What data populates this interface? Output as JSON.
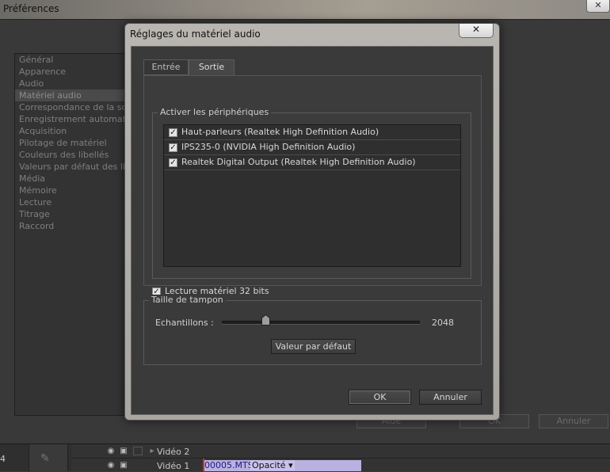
{
  "background": {
    "window_title": "Préférences",
    "close_glyph": "✕",
    "categories": [
      "Général",
      "Apparence",
      "Audio",
      "Matériel audio",
      "Correspondance de la sortie",
      "Enregistrement automatique",
      "Acquisition",
      "Pilotage de matériel",
      "Couleurs des libellés",
      "Valeurs par défaut des libellés",
      "Média",
      "Mémoire",
      "Lecture",
      "Titrage",
      "Raccord"
    ],
    "selected_category": "Matériel audio",
    "buttons": {
      "aide": "Aide",
      "ok": "OK",
      "annuler": "Annuler"
    }
  },
  "timeline": {
    "left_number": "4",
    "pen_icon": "pen-icon",
    "track_video2": "Vidéo 2",
    "track_video1": "Vidéo 1",
    "clip_name": "00005.MTS",
    "clip_property": "Opacité ▾"
  },
  "dialog": {
    "title": "Réglages du matériel audio",
    "close_glyph": "✕",
    "tabs": [
      {
        "label": "Entrée",
        "active": false
      },
      {
        "label": "Sortie",
        "active": true
      }
    ],
    "devices_group_label": "Activer les périphériques",
    "devices": [
      {
        "label": "Haut-parleurs (Realtek High Definition Audio)",
        "checked": true
      },
      {
        "label": "IPS235-0 (NVIDIA High Definition Audio)",
        "checked": true
      },
      {
        "label": "Realtek Digital Output (Realtek High Definition Audio)",
        "checked": true
      }
    ],
    "hardware_32bit_label": "Lecture matériel 32 bits",
    "hardware_32bit_checked": true,
    "buffer_group_label": "Taille de tampon",
    "samples_label": "Echantillons :",
    "samples_value": "2048",
    "default_button": "Valeur par défaut",
    "ok_button": "OK",
    "cancel_button": "Annuler"
  },
  "colors": {
    "clip": "#b9b2e0",
    "dialog_frame": "#b0ada8",
    "panel": "#3a3a3a"
  }
}
